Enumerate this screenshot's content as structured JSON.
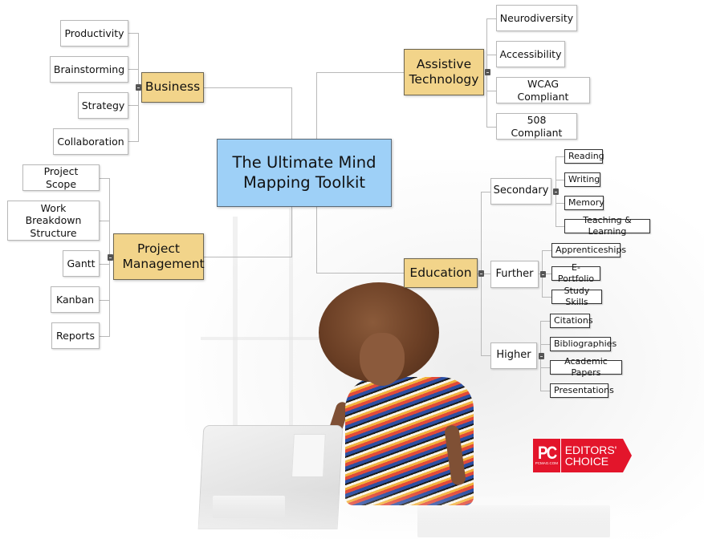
{
  "root": {
    "label": "The Ultimate Mind Mapping Toolkit"
  },
  "branches": {
    "business": {
      "label": "Business",
      "children": [
        "Productivity",
        "Brainstorming",
        "Strategy",
        "Collaboration"
      ]
    },
    "project_management": {
      "label": "Project Management",
      "children": [
        "Project Scope",
        "Work Breakdown Structure",
        "Gantt",
        "Kanban",
        "Reports"
      ]
    },
    "assistive_technology": {
      "label": "Assistive Technology",
      "children": [
        "Neurodiversity",
        "Accessibility",
        "WCAG Compliant",
        "508 Compliant"
      ]
    },
    "education": {
      "label": "Education",
      "children": [
        {
          "label": "Secondary",
          "children": [
            "Reading",
            "Writing",
            "Memory",
            "Teaching & Learning"
          ]
        },
        {
          "label": "Further",
          "children": [
            "Apprenticeships",
            "E-Portfolio",
            "Study Skills"
          ]
        },
        {
          "label": "Higher",
          "children": [
            "Citations",
            "Bibliographies",
            "Academic Papers",
            "Presentations"
          ]
        }
      ]
    }
  },
  "badge": {
    "pc": "PC",
    "site": "PCMAG.COM",
    "line1": "EDITORS'",
    "line2": "CHOICE"
  },
  "colors": {
    "root_fill": "#9ed0f7",
    "main_fill": "#f2d48a",
    "connector": "#b9b9b9",
    "badge_red": "#e3152b"
  }
}
